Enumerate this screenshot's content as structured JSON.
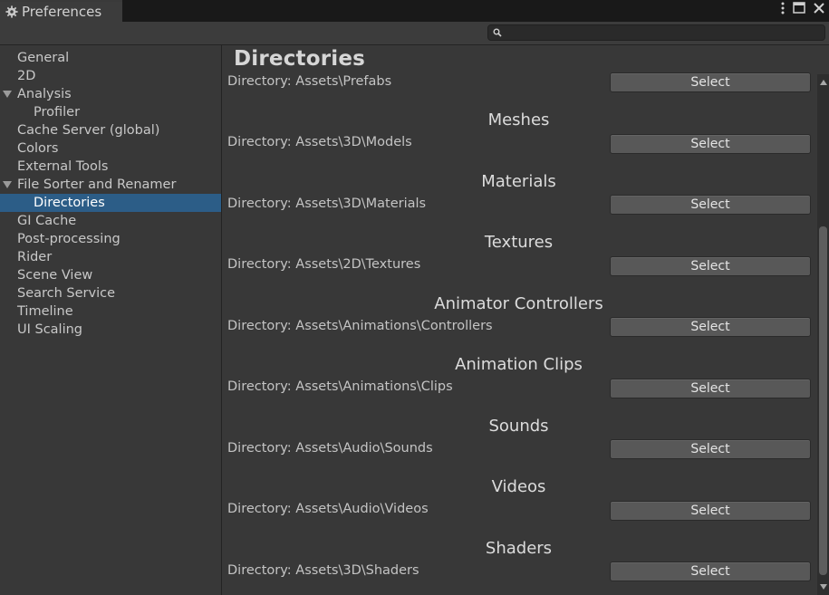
{
  "window": {
    "tab_title": "Preferences",
    "tab_icon": "gear-icon",
    "controls": [
      "more-options-icon",
      "maximize-icon",
      "close-icon"
    ]
  },
  "search": {
    "value": "",
    "icon": "search-icon"
  },
  "sidebar": {
    "items": [
      {
        "label": "General"
      },
      {
        "label": "2D"
      },
      {
        "label": "Analysis"
      },
      {
        "label": "Profiler"
      },
      {
        "label": "Cache Server (global)"
      },
      {
        "label": "Colors"
      },
      {
        "label": "External Tools"
      },
      {
        "label": "File Sorter and Renamer"
      },
      {
        "label": "Directories"
      },
      {
        "label": "GI Cache"
      },
      {
        "label": "Post-processing"
      },
      {
        "label": "Rider"
      },
      {
        "label": "Scene View"
      },
      {
        "label": "Search Service"
      },
      {
        "label": "Timeline"
      },
      {
        "label": "UI Scaling"
      }
    ],
    "selected": "Directories"
  },
  "main": {
    "heading": "Directories",
    "first_row": {
      "directory": "Directory: Assets\\Prefabs",
      "button": "Select"
    },
    "sections": [
      {
        "title": "Meshes",
        "directory": "Directory: Assets\\3D\\Models",
        "button": "Select"
      },
      {
        "title": "Materials",
        "directory": "Directory: Assets\\3D\\Materials",
        "button": "Select"
      },
      {
        "title": "Textures",
        "directory": "Directory: Assets\\2D\\Textures",
        "button": "Select"
      },
      {
        "title": "Animator Controllers",
        "directory": "Directory: Assets\\Animations\\Controllers",
        "button": "Select"
      },
      {
        "title": "Animation Clips",
        "directory": "Directory: Assets\\Animations\\Clips",
        "button": "Select"
      },
      {
        "title": "Sounds",
        "directory": "Directory: Assets\\Audio\\Sounds",
        "button": "Select"
      },
      {
        "title": "Videos",
        "directory": "Directory: Assets\\Audio\\Videos",
        "button": "Select"
      },
      {
        "title": "Shaders",
        "directory": "Directory: Assets\\3D\\Shaders",
        "button": "Select"
      }
    ]
  },
  "colors": {
    "background": "#383838",
    "selection": "#2c5d87",
    "button": "#585858",
    "titlebar": "#191919"
  }
}
